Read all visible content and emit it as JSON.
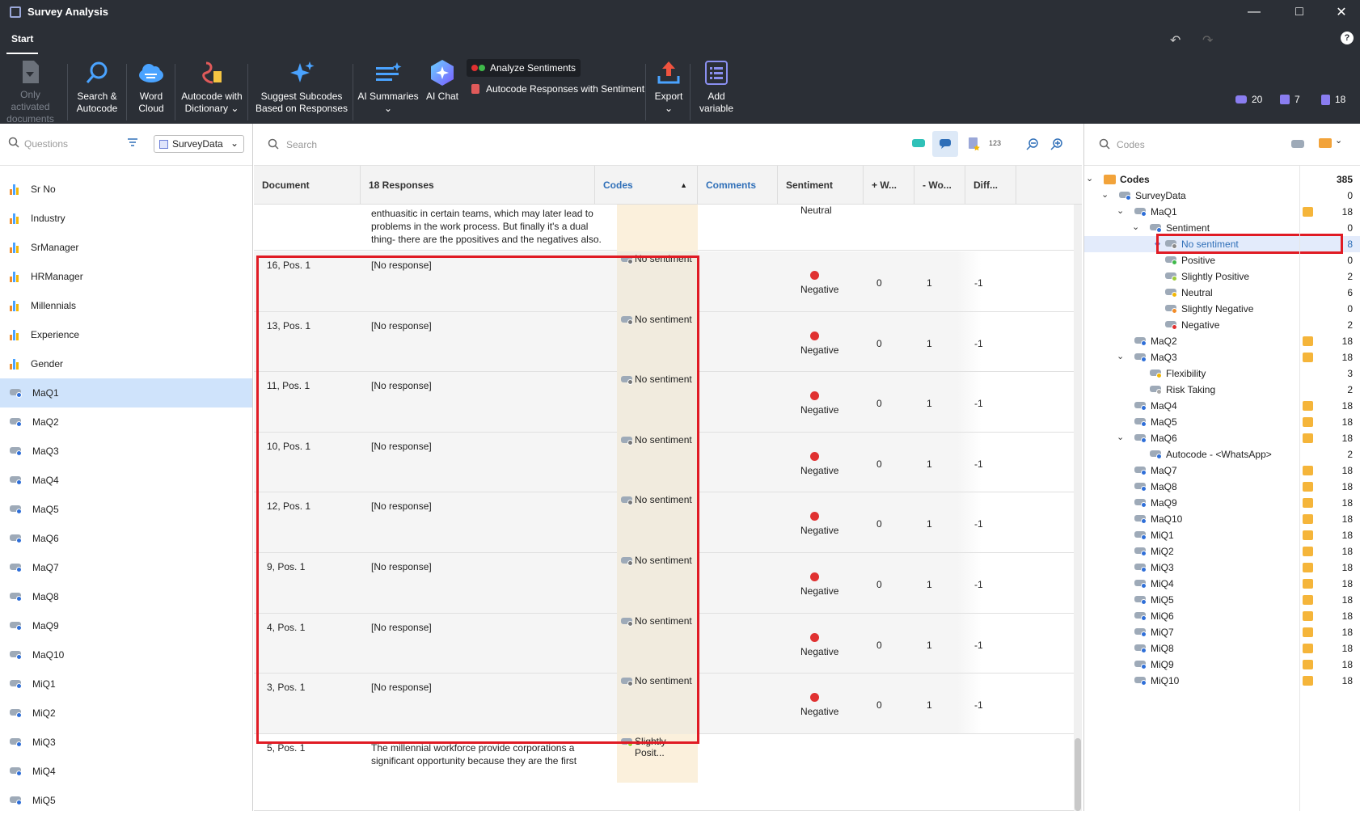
{
  "window": {
    "title": "Survey Analysis"
  },
  "tabs": {
    "start": "Start"
  },
  "ribbon": {
    "only_activated_l1": "Only activated",
    "only_activated_l2": "documents",
    "search_l1": "Search &",
    "search_l2": "Autocode",
    "wordcloud_l1": "Word",
    "wordcloud_l2": "Cloud",
    "dict_l1": "Autocode with",
    "dict_l2": "Dictionary",
    "subcodes_l1": "Suggest Subcodes",
    "subcodes_l2": "Based on Responses",
    "summaries": "AI Summaries",
    "aichat": "AI Chat",
    "analyze": "Analyze Sentiments",
    "autocode_sent": "Autocode Responses with Sentiment",
    "export": "Export",
    "addvar_l1": "Add",
    "addvar_l2": "variable",
    "count_codes": "20",
    "count_memos": "7",
    "count_docs": "18"
  },
  "left": {
    "search_placeholder": "Questions",
    "dataset": "SurveyData",
    "items": [
      {
        "label": "Sr No",
        "type": "var"
      },
      {
        "label": "Industry",
        "type": "var"
      },
      {
        "label": "SrManager",
        "type": "var"
      },
      {
        "label": "HRManager",
        "type": "var"
      },
      {
        "label": "Millennials",
        "type": "var"
      },
      {
        "label": "Experience",
        "type": "var"
      },
      {
        "label": "Gender",
        "type": "var"
      },
      {
        "label": "MaQ1",
        "type": "code"
      },
      {
        "label": "MaQ2",
        "type": "code"
      },
      {
        "label": "MaQ3",
        "type": "code"
      },
      {
        "label": "MaQ4",
        "type": "code"
      },
      {
        "label": "MaQ5",
        "type": "code"
      },
      {
        "label": "MaQ6",
        "type": "code"
      },
      {
        "label": "MaQ7",
        "type": "code"
      },
      {
        "label": "MaQ8",
        "type": "code"
      },
      {
        "label": "MaQ9",
        "type": "code"
      },
      {
        "label": "MaQ10",
        "type": "code"
      },
      {
        "label": "MiQ1",
        "type": "code"
      },
      {
        "label": "MiQ2",
        "type": "code"
      },
      {
        "label": "MiQ3",
        "type": "code"
      },
      {
        "label": "MiQ4",
        "type": "code"
      },
      {
        "label": "MiQ5",
        "type": "code"
      }
    ]
  },
  "center": {
    "search_placeholder": "Search",
    "numeric_icon_label": "123",
    "headers": {
      "document": "Document",
      "responses": "18 Responses",
      "codes": "Codes",
      "comments": "Comments",
      "sentiment": "Sentiment",
      "plus_words": "+ W...",
      "minus_words": "- Wo...",
      "diff": "Diff..."
    },
    "partial_top": {
      "lines": [
        "enthuasitic in certain teams, which may later lead to",
        "problems in the work process. But finally it's a dual",
        "thing- there are the ppositives and the negatives also."
      ],
      "sentiment": "Neutral"
    },
    "rows": [
      {
        "doc": "16, Pos. 1",
        "response": "[No response]",
        "code": "No sentiment",
        "sentiment": "Negative",
        "plus": "0",
        "minus": "1",
        "diff": "-1"
      },
      {
        "doc": "13, Pos. 1",
        "response": "[No response]",
        "code": "No sentiment",
        "sentiment": "Negative",
        "plus": "0",
        "minus": "1",
        "diff": "-1"
      },
      {
        "doc": "11, Pos. 1",
        "response": "[No response]",
        "code": "No sentiment",
        "sentiment": "Negative",
        "plus": "0",
        "minus": "1",
        "diff": "-1"
      },
      {
        "doc": "10, Pos. 1",
        "response": "[No response]",
        "code": "No sentiment",
        "sentiment": "Negative",
        "plus": "0",
        "minus": "1",
        "diff": "-1"
      },
      {
        "doc": "12, Pos. 1",
        "response": "[No response]",
        "code": "No sentiment",
        "sentiment": "Negative",
        "plus": "0",
        "minus": "1",
        "diff": "-1"
      },
      {
        "doc": "9, Pos. 1",
        "response": "[No response]",
        "code": "No sentiment",
        "sentiment": "Negative",
        "plus": "0",
        "minus": "1",
        "diff": "-1"
      },
      {
        "doc": "4, Pos. 1",
        "response": "[No response]",
        "code": "No sentiment",
        "sentiment": "Negative",
        "plus": "0",
        "minus": "1",
        "diff": "-1"
      },
      {
        "doc": "3, Pos. 1",
        "response": "[No response]",
        "code": "No sentiment",
        "sentiment": "Negative",
        "plus": "0",
        "minus": "1",
        "diff": "-1"
      }
    ],
    "partial_bottom": {
      "doc": "5, Pos. 1",
      "lines": [
        "The millennial workforce provide corporations a",
        "significant opportunity because they are the first"
      ],
      "code": "Slightly Posit..."
    }
  },
  "right": {
    "search_placeholder": "Codes",
    "tree": [
      {
        "label": "Codes",
        "count": "385",
        "level": 0,
        "chev": "v",
        "icon": "folder",
        "bold": true
      },
      {
        "label": "SurveyData",
        "count": "0",
        "level": 1,
        "chev": "v",
        "icon": "code"
      },
      {
        "label": "MaQ1",
        "count": "18",
        "level": 2,
        "chev": "v",
        "icon": "code",
        "memo": true,
        "dot": "#2f6fd8"
      },
      {
        "label": "Sentiment",
        "count": "0",
        "level": 3,
        "chev": "v",
        "icon": "code",
        "dot": "#2f6fd8"
      },
      {
        "label": "No sentiment",
        "count": "8",
        "level": 4,
        "icon": "code",
        "dot": "#888",
        "sel": true
      },
      {
        "label": "Positive",
        "count": "0",
        "level": 4,
        "icon": "code",
        "dot": "#3fb94a"
      },
      {
        "label": "Slightly Positive",
        "count": "2",
        "level": 4,
        "icon": "code",
        "dot": "#9ccc3a"
      },
      {
        "label": "Neutral",
        "count": "6",
        "level": 4,
        "icon": "code",
        "dot": "#f2b705"
      },
      {
        "label": "Slightly Negative",
        "count": "0",
        "level": 4,
        "icon": "code",
        "dot": "#f28c28"
      },
      {
        "label": "Negative",
        "count": "2",
        "level": 4,
        "icon": "code",
        "dot": "#e03131"
      },
      {
        "label": "MaQ2",
        "count": "18",
        "level": 2,
        "icon": "code",
        "memo": true,
        "dot": "#2f6fd8"
      },
      {
        "label": "MaQ3",
        "count": "18",
        "level": 2,
        "chev": "v",
        "icon": "code",
        "memo": true,
        "dot": "#2f6fd8"
      },
      {
        "label": "Flexibility",
        "count": "3",
        "level": 3,
        "icon": "code",
        "dot": "#f2b705"
      },
      {
        "label": "Risk Taking",
        "count": "2",
        "level": 3,
        "icon": "code",
        "dot": "#aaa"
      },
      {
        "label": "MaQ4",
        "count": "18",
        "level": 2,
        "icon": "code",
        "memo": true,
        "dot": "#2f6fd8"
      },
      {
        "label": "MaQ5",
        "count": "18",
        "level": 2,
        "icon": "code",
        "memo": true,
        "dot": "#2f6fd8"
      },
      {
        "label": "MaQ6",
        "count": "18",
        "level": 2,
        "chev": "v",
        "icon": "code",
        "memo": true,
        "dot": "#2f6fd8"
      },
      {
        "label": "Autocode - <WhatsApp>",
        "count": "2",
        "level": 3,
        "icon": "code",
        "dot": "#2f6fd8"
      },
      {
        "label": "MaQ7",
        "count": "18",
        "level": 2,
        "icon": "code",
        "memo": true,
        "dot": "#2f6fd8"
      },
      {
        "label": "MaQ8",
        "count": "18",
        "level": 2,
        "icon": "code",
        "memo": true,
        "dot": "#2f6fd8"
      },
      {
        "label": "MaQ9",
        "count": "18",
        "level": 2,
        "icon": "code",
        "memo": true,
        "dot": "#2f6fd8"
      },
      {
        "label": "MaQ10",
        "count": "18",
        "level": 2,
        "icon": "code",
        "memo": true,
        "dot": "#2f6fd8"
      },
      {
        "label": "MiQ1",
        "count": "18",
        "level": 2,
        "icon": "code",
        "memo": true,
        "dot": "#2f6fd8"
      },
      {
        "label": "MiQ2",
        "count": "18",
        "level": 2,
        "icon": "code",
        "memo": true,
        "dot": "#2f6fd8"
      },
      {
        "label": "MiQ3",
        "count": "18",
        "level": 2,
        "icon": "code",
        "memo": true,
        "dot": "#2f6fd8"
      },
      {
        "label": "MiQ4",
        "count": "18",
        "level": 2,
        "icon": "code",
        "memo": true,
        "dot": "#2f6fd8"
      },
      {
        "label": "MiQ5",
        "count": "18",
        "level": 2,
        "icon": "code",
        "memo": true,
        "dot": "#2f6fd8"
      },
      {
        "label": "MiQ6",
        "count": "18",
        "level": 2,
        "icon": "code",
        "memo": true,
        "dot": "#2f6fd8"
      },
      {
        "label": "MiQ7",
        "count": "18",
        "level": 2,
        "icon": "code",
        "memo": true,
        "dot": "#2f6fd8"
      },
      {
        "label": "MiQ8",
        "count": "18",
        "level": 2,
        "icon": "code",
        "memo": true,
        "dot": "#2f6fd8"
      },
      {
        "label": "MiQ9",
        "count": "18",
        "level": 2,
        "icon": "code",
        "memo": true,
        "dot": "#2f6fd8"
      },
      {
        "label": "MiQ10",
        "count": "18",
        "level": 2,
        "icon": "code",
        "memo": true,
        "dot": "#2f6fd8"
      }
    ]
  },
  "colors": {
    "accent": "#2f6fb8",
    "highlight_box": "#e01b24",
    "negative_dot": "#e03131",
    "codes_column": "#fbf0dc",
    "selection": "#cfe3fb"
  }
}
